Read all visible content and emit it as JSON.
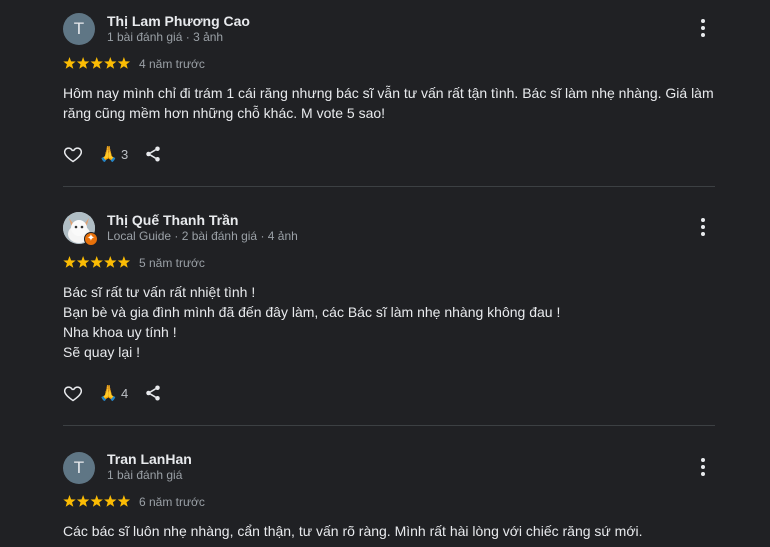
{
  "reviews": [
    {
      "avatar_letter": "T",
      "name": "Thị Lam Phương Cao",
      "meta": "1 bài đánh giá · 3 ảnh",
      "stars": 5,
      "time": "4 năm trước",
      "text": [
        "Hôm nay mình chỉ đi trám 1 cái răng nhưng bác sĩ vẫn tư vấn rất tận tình. Bác sĩ làm nhẹ nhàng. Giá làm răng cũng mềm hơn những chỗ khác. M vote 5 sao!"
      ],
      "reaction_count": "3"
    },
    {
      "avatar_letter": "",
      "name": "Thị Quế Thanh Trần",
      "meta": "Local Guide · 2 bài đánh giá · 4 ảnh",
      "stars": 5,
      "time": "5 năm trước",
      "text": [
        "Bác sĩ rất tư vấn rất nhiệt tình !",
        "Bạn bè và gia đình mình đã đến đây làm, các Bác sĩ làm nhẹ nhàng không đau !",
        "Nha khoa uy tính !",
        "Sẽ quay lại !"
      ],
      "reaction_count": "4"
    },
    {
      "avatar_letter": "T",
      "name": "Tran LanHan",
      "meta": "1 bài đánh giá",
      "stars": 5,
      "time": "6 năm trước",
      "text": [
        "Các bác sĩ luôn nhẹ nhàng, cẩn thận, tư vấn rõ ràng. Mình rất hài lòng với chiếc răng sứ mới."
      ]
    }
  ],
  "icons": {
    "thanks_emoji": "🙏",
    "star_color": "#fbbc04"
  }
}
